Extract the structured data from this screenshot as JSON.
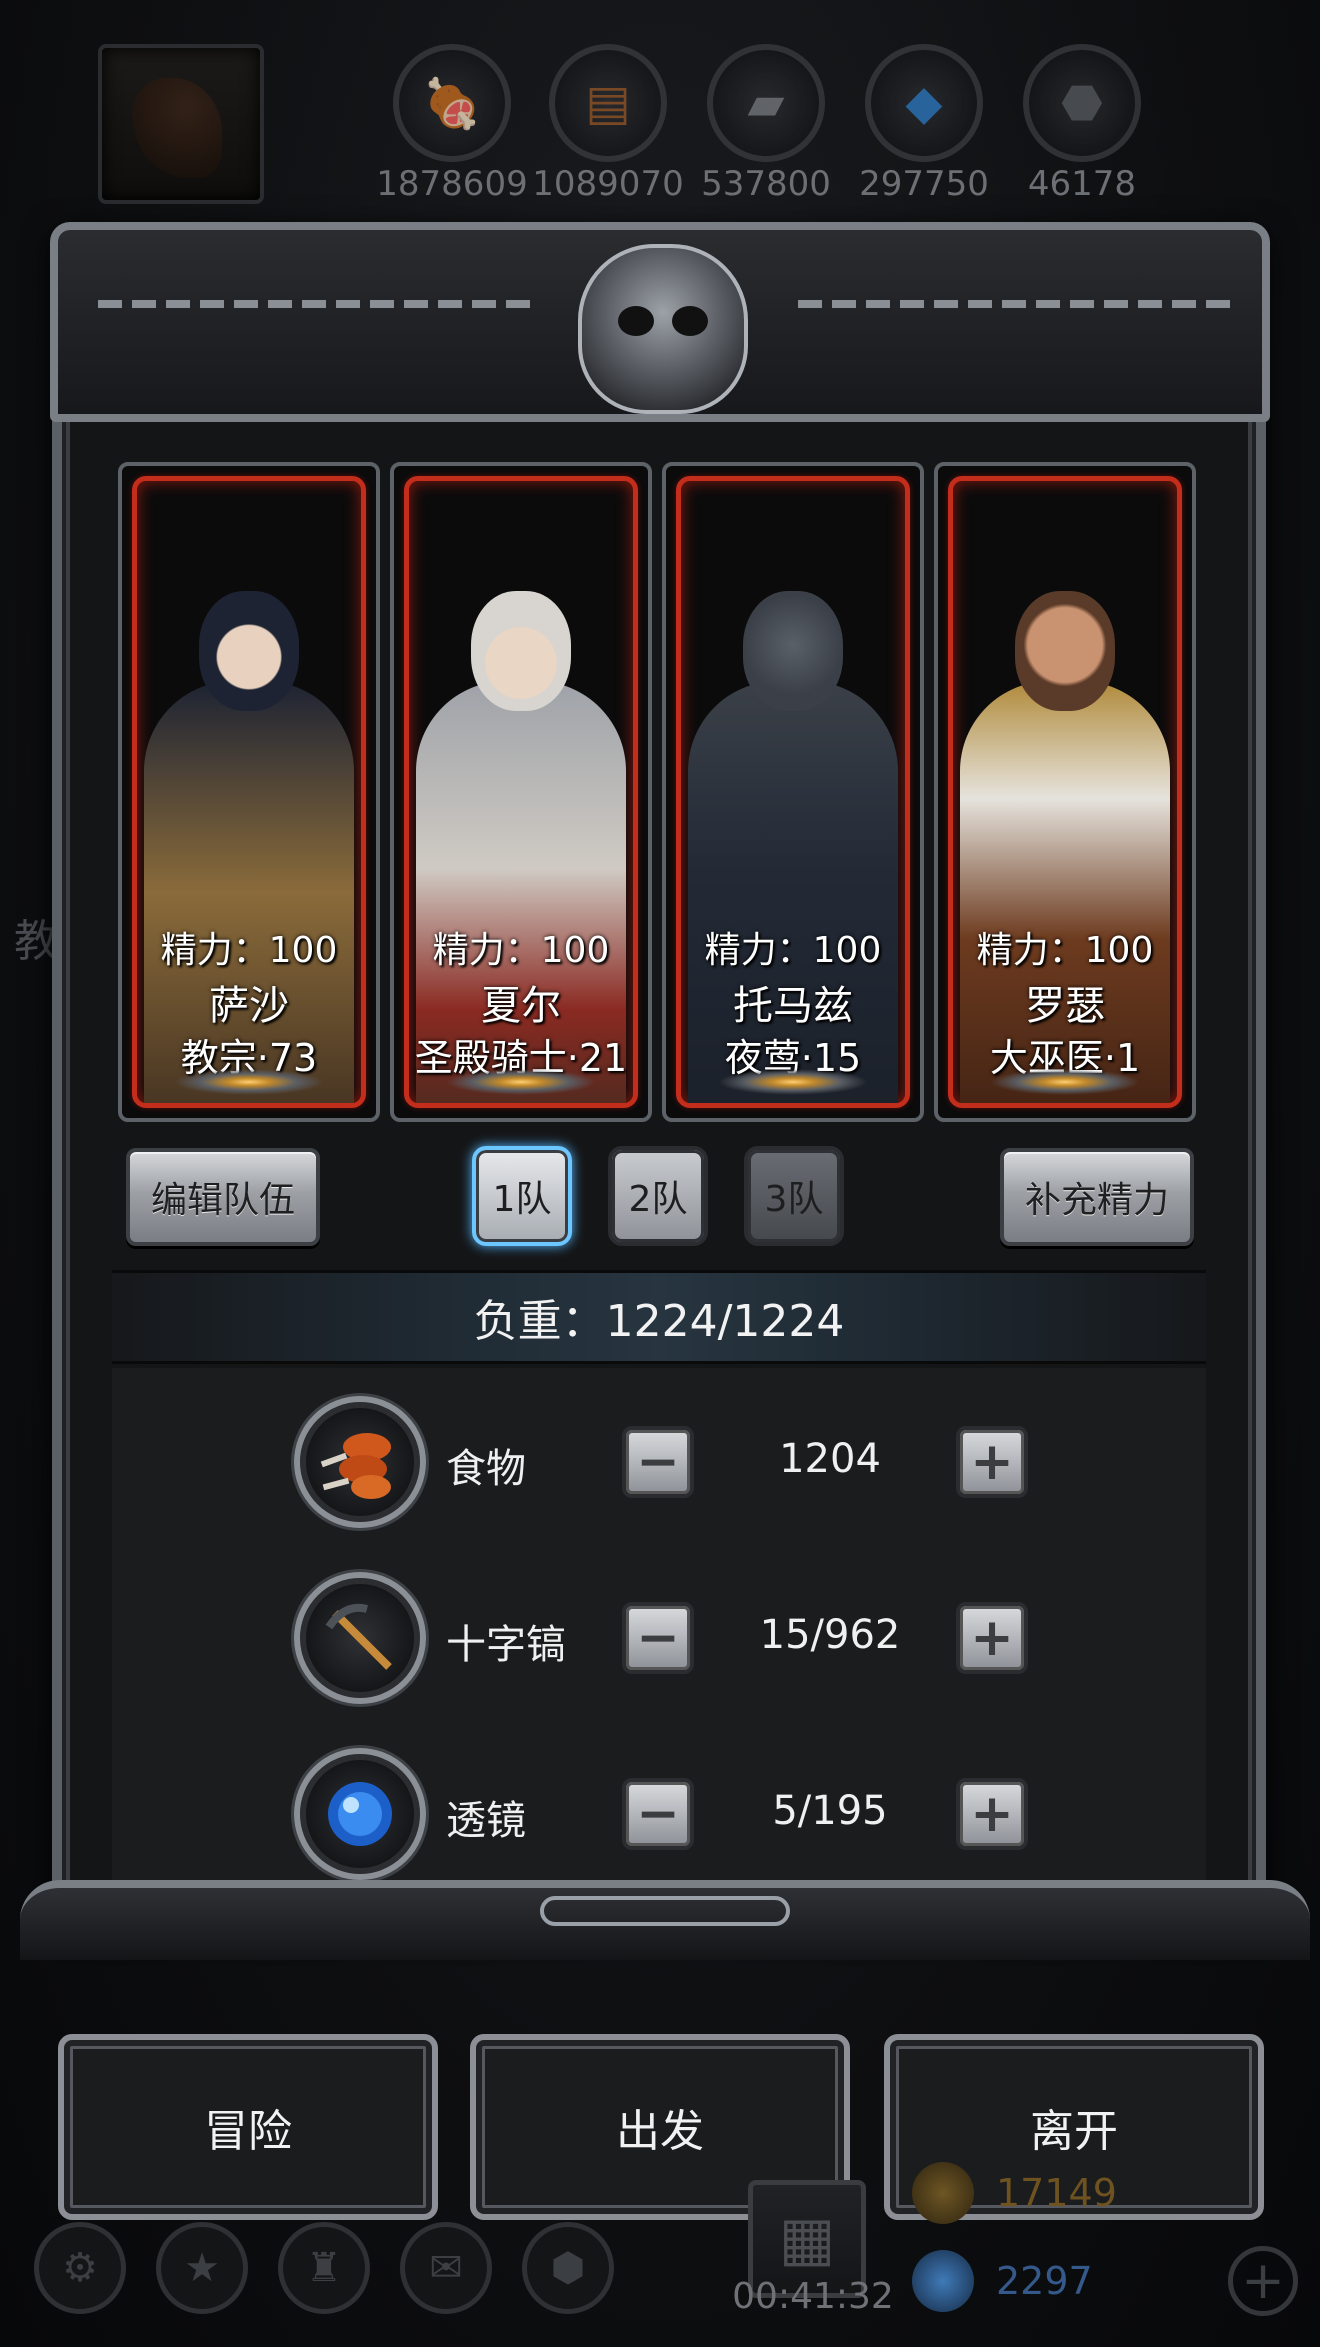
{
  "side_text": "教",
  "resources": [
    {
      "icon": "meat-icon",
      "value": "1878609",
      "color": "#c0501e",
      "glyph": "🍖"
    },
    {
      "icon": "wood-icon",
      "value": "1089070",
      "color": "#9a5a2a",
      "glyph": "🪵"
    },
    {
      "icon": "iron-ingot-icon",
      "value": "537800",
      "color": "#6d7176",
      "glyph": "▰"
    },
    {
      "icon": "crystal-icon",
      "value": "297750",
      "color": "#2f7fc8",
      "glyph": "◆"
    },
    {
      "icon": "dark-ore-icon",
      "value": "46178",
      "color": "#5a5d62",
      "glyph": "⬣"
    }
  ],
  "heroes": [
    {
      "energy": "精力：100",
      "name": "萨沙",
      "klass": "教宗·73",
      "palette": {
        "hood": "#1d2333",
        "robe": "#8a6b3a",
        "skin": "#e8d2bf"
      }
    },
    {
      "energy": "精力：100",
      "name": "夏尔",
      "klass": "圣殿骑士·21",
      "palette": {
        "hood": "#d8d4cf",
        "robe": "#cfcac3",
        "skin": "#ead6c4"
      }
    },
    {
      "energy": "精力：100",
      "name": "托马兹",
      "klass": "夜莺·15",
      "palette": {
        "hood": "#3b4048",
        "robe": "#232a36",
        "skin": "#3a3e45"
      }
    },
    {
      "energy": "精力：100",
      "name": "罗瑟",
      "klass": "大巫医·1",
      "palette": {
        "hood": "#5a3a28",
        "robe": "#6d3b1f",
        "skin": "#c99270"
      }
    }
  ],
  "buttons": {
    "edit_team": "编辑队伍",
    "team1": "1队",
    "team2": "2队",
    "team3": "3队",
    "refill_energy": "补充精力"
  },
  "weight": "负重：1224/1224",
  "supplies": [
    {
      "icon": "meat-icon",
      "label": "食物",
      "value": "1204",
      "minus": "−",
      "plus": "+"
    },
    {
      "icon": "pickaxe-icon",
      "label": "十字镐",
      "value": "15/962",
      "minus": "−",
      "plus": "+"
    },
    {
      "icon": "lens-icon",
      "label": "透镜",
      "value": "5/195",
      "minus": "−",
      "plus": "+"
    }
  ],
  "actions": {
    "adventure": "冒险",
    "depart": "出发",
    "leave": "离开"
  },
  "hud": {
    "timer": "00:41:32",
    "gold": "17149",
    "gems": "2297",
    "icons": [
      "settings-icon",
      "star-icon",
      "tower-icon",
      "mail-icon",
      "crate-icon"
    ]
  },
  "colors": {
    "accent_red": "#c32d1c",
    "active_blue": "#6cc6ff",
    "gold": "#b8872c",
    "gem_blue": "#3a6ab0"
  }
}
